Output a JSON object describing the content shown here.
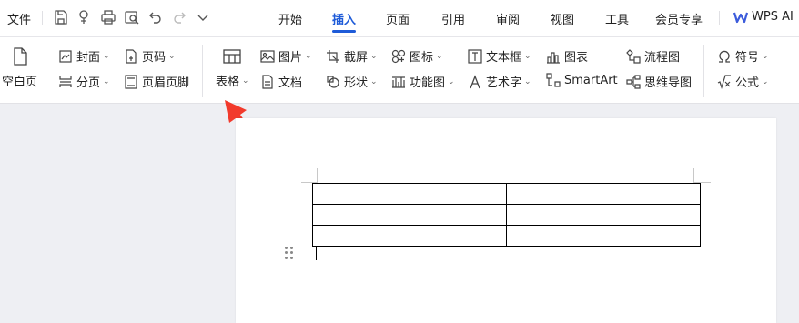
{
  "menu": {
    "file": "文件"
  },
  "tabs": [
    "开始",
    "插入",
    "页面",
    "引用",
    "审阅",
    "视图",
    "工具",
    "会员专享"
  ],
  "ai_label": "WPS AI",
  "ribbon": {
    "blank_page": "空白页",
    "cover": "封面",
    "page_break": "分页",
    "page_number": "页码",
    "header_footer": "页眉页脚",
    "table": "表格",
    "picture": "图片",
    "document": "文档",
    "screenshot": "截屏",
    "shape": "形状",
    "icon": "图标",
    "function_chart": "功能图",
    "textbox": "文本框",
    "wordart": "艺术字",
    "chart": "图表",
    "smartart": "SmartArt",
    "flowchart": "流程图",
    "mindmap": "思维导图",
    "symbol": "符号",
    "formula": "公式"
  },
  "colors": {
    "accent": "#1e5bd8",
    "arrow": "#f23a2c"
  }
}
